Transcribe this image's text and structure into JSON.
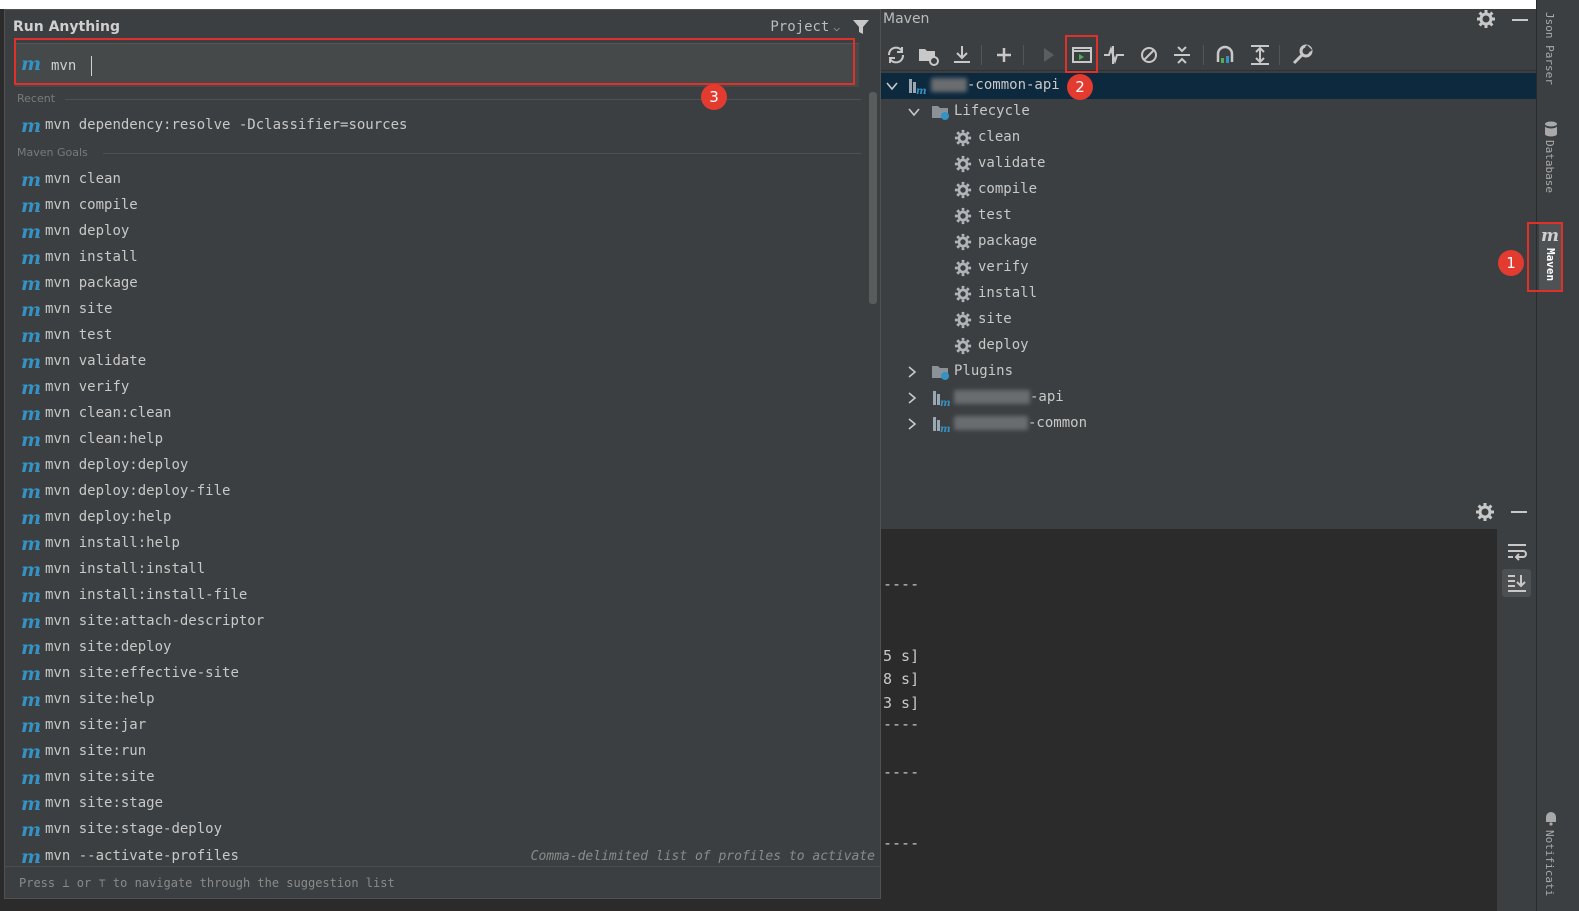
{
  "run_anything": {
    "title": "Run Anything",
    "scope": "Project",
    "input_value": "mvn",
    "section_recent": "Recent",
    "section_goals": "Maven Goals",
    "recent": [
      {
        "cmd": "mvn",
        "args": "dependency:resolve -Dclassifier=sources"
      }
    ],
    "goals": [
      {
        "cmd": "mvn",
        "args": "clean"
      },
      {
        "cmd": "mvn",
        "args": "compile"
      },
      {
        "cmd": "mvn",
        "args": "deploy"
      },
      {
        "cmd": "mvn",
        "args": "install"
      },
      {
        "cmd": "mvn",
        "args": "package"
      },
      {
        "cmd": "mvn",
        "args": "site"
      },
      {
        "cmd": "mvn",
        "args": "test"
      },
      {
        "cmd": "mvn",
        "args": "validate"
      },
      {
        "cmd": "mvn",
        "args": "verify"
      },
      {
        "cmd": "mvn",
        "args": "clean:clean"
      },
      {
        "cmd": "mvn",
        "args": "clean:help"
      },
      {
        "cmd": "mvn",
        "args": "deploy:deploy"
      },
      {
        "cmd": "mvn",
        "args": "deploy:deploy-file"
      },
      {
        "cmd": "mvn",
        "args": "deploy:help"
      },
      {
        "cmd": "mvn",
        "args": "install:help"
      },
      {
        "cmd": "mvn",
        "args": "install:install"
      },
      {
        "cmd": "mvn",
        "args": "install:install-file"
      },
      {
        "cmd": "mvn",
        "args": "site:attach-descriptor"
      },
      {
        "cmd": "mvn",
        "args": "site:deploy"
      },
      {
        "cmd": "mvn",
        "args": "site:effective-site"
      },
      {
        "cmd": "mvn",
        "args": "site:help"
      },
      {
        "cmd": "mvn",
        "args": "site:jar"
      },
      {
        "cmd": "mvn",
        "args": "site:run"
      },
      {
        "cmd": "mvn",
        "args": "site:site"
      },
      {
        "cmd": "mvn",
        "args": "site:stage"
      },
      {
        "cmd": "mvn",
        "args": "site:stage-deploy"
      }
    ],
    "last_row": {
      "cmd": "mvn",
      "args": "--activate-profiles",
      "hint": "Comma-delimited list of profiles to activate"
    },
    "footer": "Press ⊥ or ⊤ to navigate through the suggestion list"
  },
  "maven": {
    "title": "Maven",
    "root_suffix": "-common-api",
    "lifecycle_label": "Lifecycle",
    "lifecycle": [
      "clean",
      "validate",
      "compile",
      "test",
      "package",
      "verify",
      "install",
      "site",
      "deploy"
    ],
    "plugins_label": "Plugins",
    "modules": [
      "-api",
      "-common"
    ]
  },
  "console": {
    "lines": [
      "----",
      "5 s]",
      "8 s]",
      "3 s]",
      "----",
      "----",
      "----"
    ]
  },
  "right_strip": {
    "json_parser": "Json Parser",
    "database": "Database",
    "maven": "Maven",
    "notifications": "Notificati"
  },
  "annotations": {
    "badge_1": "1",
    "badge_2": "2",
    "badge_3": "3",
    "color": "#e33b30"
  },
  "colors": {
    "panel_bg": "#3c3f41",
    "editor_bg": "#2b2b2b",
    "maven_icon": "#3592c4",
    "selection": "#0d293e"
  }
}
